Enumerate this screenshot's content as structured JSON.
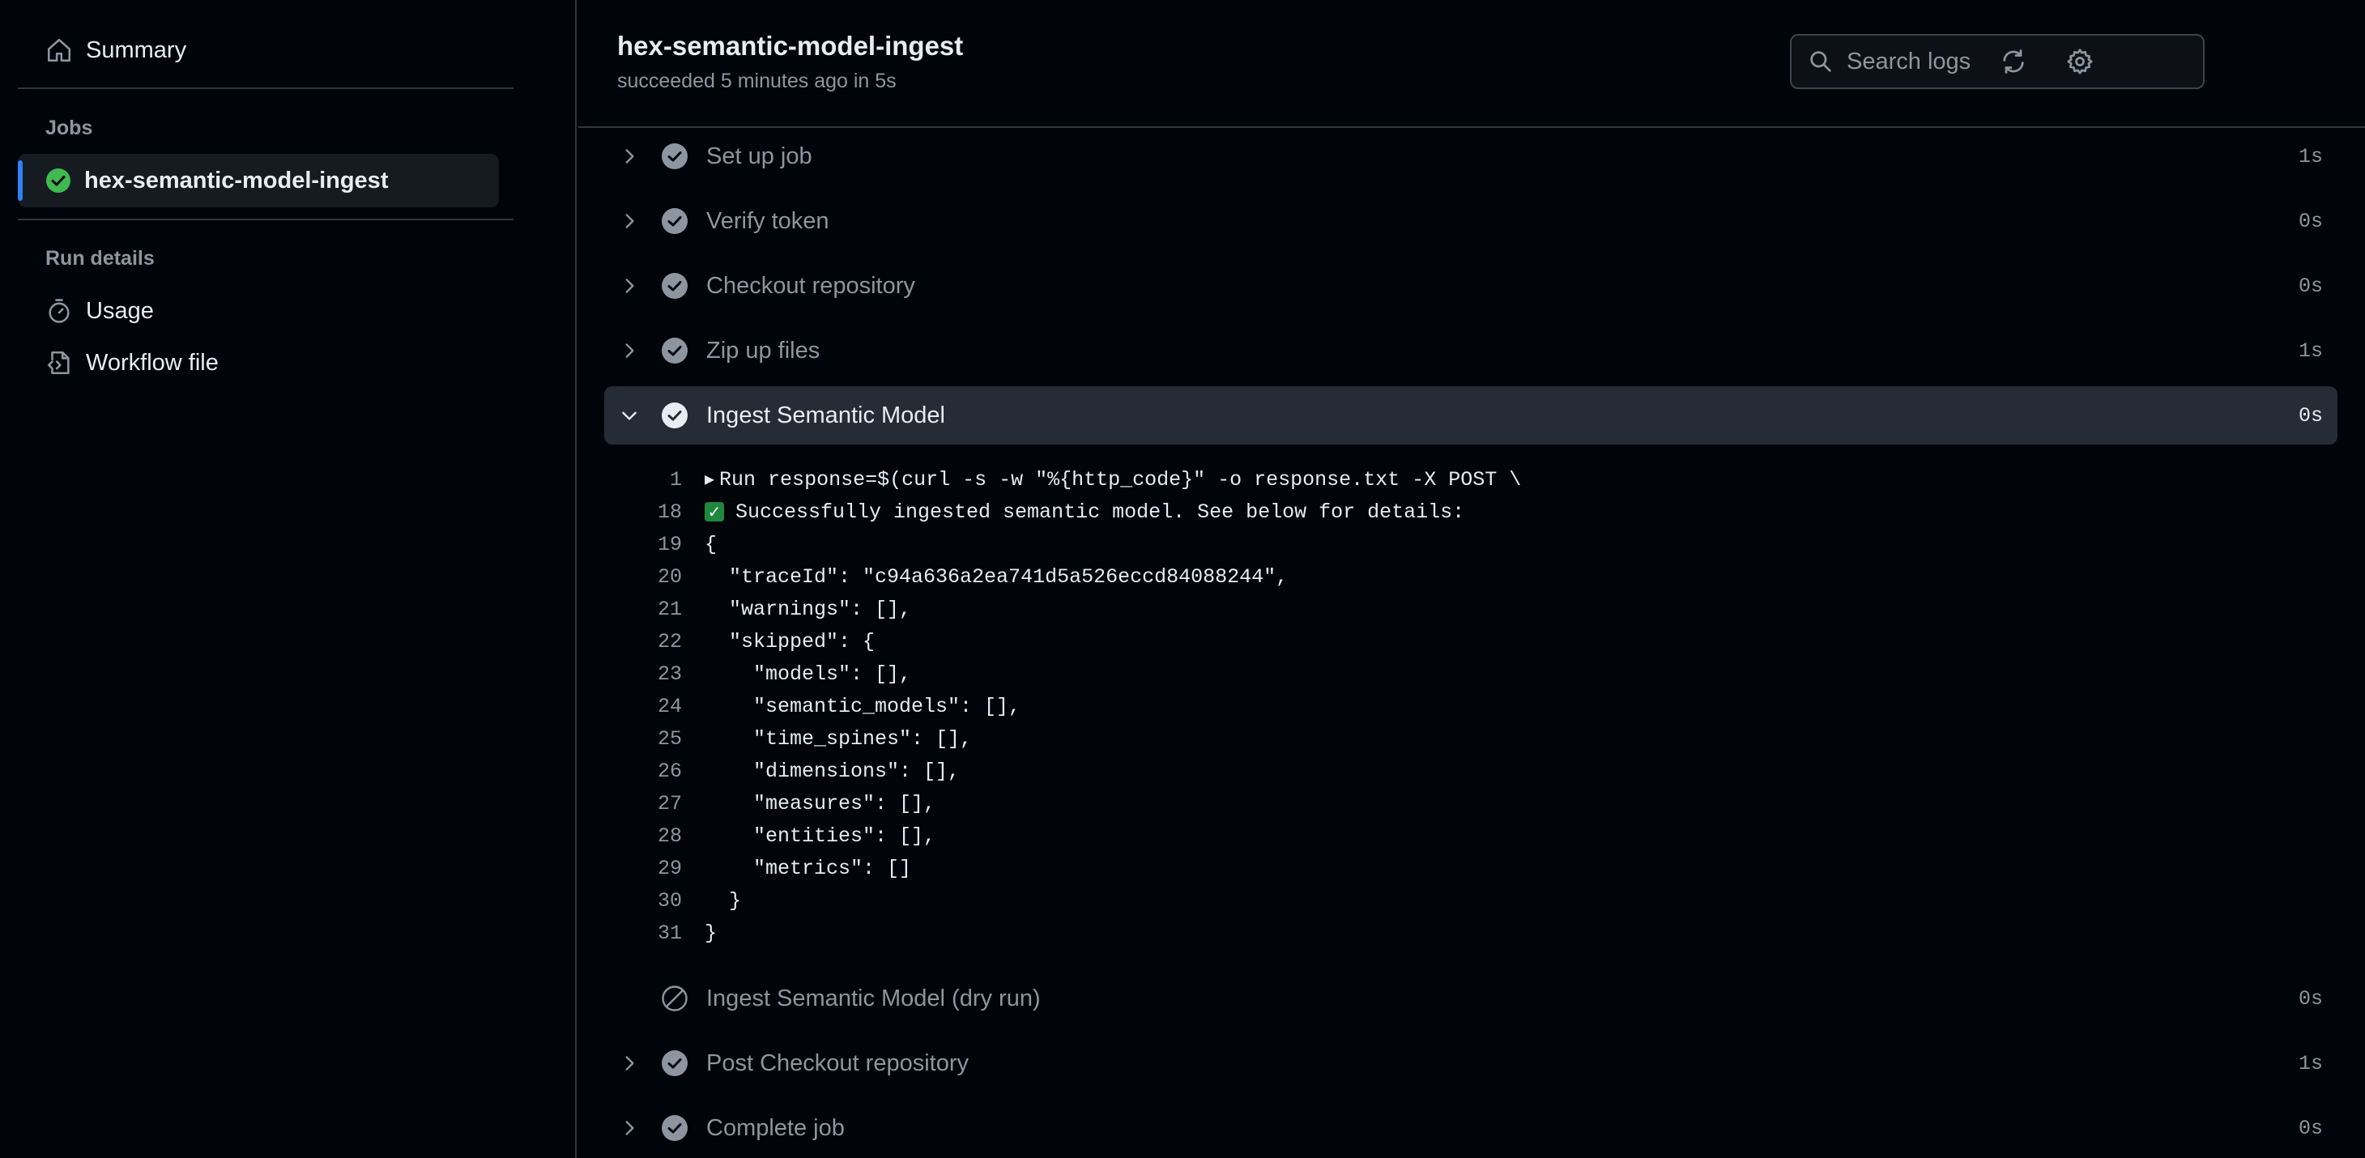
{
  "sidebar": {
    "summary_label": "Summary",
    "jobs_heading": "Jobs",
    "active_job": "hex-semantic-model-ingest",
    "run_details_heading": "Run details",
    "usage_label": "Usage",
    "workflow_file_label": "Workflow file"
  },
  "header": {
    "title": "hex-semantic-model-ingest",
    "status": "succeeded 5 minutes ago in 5s",
    "search_placeholder": "Search logs"
  },
  "steps": [
    {
      "name": "Set up job",
      "duration": "1s",
      "state": "success"
    },
    {
      "name": "Verify token",
      "duration": "0s",
      "state": "success"
    },
    {
      "name": "Checkout repository",
      "duration": "0s",
      "state": "success"
    },
    {
      "name": "Zip up files",
      "duration": "1s",
      "state": "success"
    },
    {
      "name": "Ingest Semantic Model",
      "duration": "0s",
      "state": "success",
      "expanded": true
    },
    {
      "name": "Ingest Semantic Model (dry run)",
      "duration": "0s",
      "state": "skipped"
    },
    {
      "name": "Post Checkout repository",
      "duration": "1s",
      "state": "success"
    },
    {
      "name": "Complete job",
      "duration": "0s",
      "state": "success"
    }
  ],
  "log_lines": [
    {
      "num": "1",
      "text": "Run response=$(curl -s -w \"%{http_code}\" -o response.txt -X POST \\"
    },
    {
      "num": "18",
      "text": "Successfully ingested semantic model. See below for details:"
    },
    {
      "num": "19",
      "text": "{"
    },
    {
      "num": "20",
      "text": "  \"traceId\": \"c94a636a2ea741d5a526eccd84088244\","
    },
    {
      "num": "21",
      "text": "  \"warnings\": [],"
    },
    {
      "num": "22",
      "text": "  \"skipped\": {"
    },
    {
      "num": "23",
      "text": "    \"models\": [],"
    },
    {
      "num": "24",
      "text": "    \"semantic_models\": [],"
    },
    {
      "num": "25",
      "text": "    \"time_spines\": [],"
    },
    {
      "num": "26",
      "text": "    \"dimensions\": [],"
    },
    {
      "num": "27",
      "text": "    \"measures\": [],"
    },
    {
      "num": "28",
      "text": "    \"entities\": [],"
    },
    {
      "num": "29",
      "text": "    \"metrics\": []"
    },
    {
      "num": "30",
      "text": "  }"
    },
    {
      "num": "31",
      "text": "}"
    }
  ],
  "colors": {
    "success_green": "#3fb950",
    "step_check_gray": "#8d96a0",
    "active_bar_blue": "#2f81f7"
  }
}
